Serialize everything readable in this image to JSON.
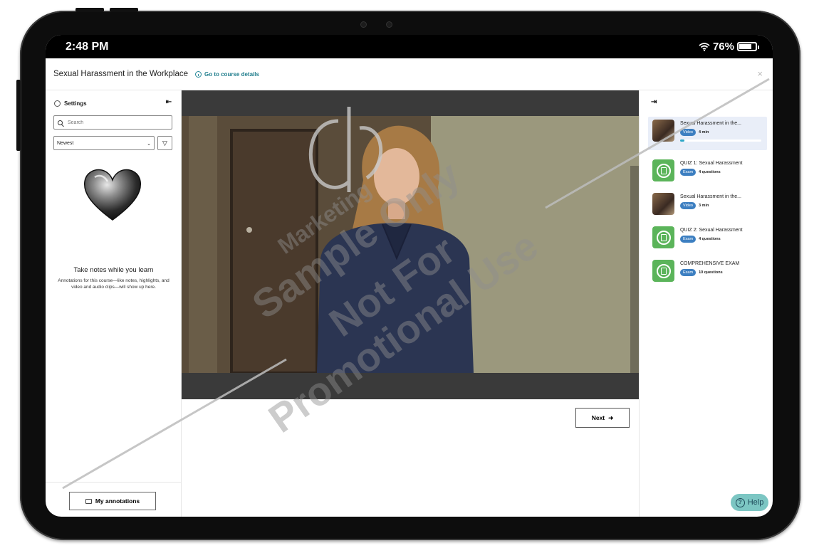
{
  "status": {
    "time": "2:48 PM",
    "battery": "76%",
    "battery_fraction": 0.76
  },
  "header": {
    "title": "Sexual Harassment in the Workplace",
    "details_link": "Go to course details",
    "close": "×"
  },
  "left": {
    "settings_label": "Settings",
    "collapse_icon": "⇤",
    "search_placeholder": "Search",
    "sort_value": "Newest",
    "sort_chevron": "⌄",
    "filter_icon": "▽",
    "notes_title": "Take notes while you learn",
    "notes_description": "Annotations for this course—like notes, highlights, and video and audio clips—will show up here.",
    "annotations_button": "My annotations"
  },
  "center": {
    "next_label": "Next",
    "next_arrow": "➜"
  },
  "right": {
    "expand_icon": "⇥",
    "items": [
      {
        "title": "Sexual Harassment in the...",
        "type": "Video",
        "meta": "4 min",
        "progress": 0.05
      },
      {
        "title": "QUIZ 1: Sexual Harassment",
        "type": "Exam",
        "meta": "4 questions"
      },
      {
        "title": "Sexual Harassment in the...",
        "type": "Video",
        "meta": "3 min"
      },
      {
        "title": "QUIZ 2: Sexual Harassment",
        "type": "Exam",
        "meta": "4 questions"
      },
      {
        "title": "COMPREHENSIVE EXAM",
        "type": "Exam",
        "meta": "10 questions"
      }
    ]
  },
  "help": {
    "label": "Help",
    "icon": "?"
  },
  "watermark": {
    "line1": "Marketing",
    "line2": "Sample Only",
    "line3": "Not For",
    "line4": "Promotional Use"
  },
  "colors": {
    "accent": "#1f7d8c",
    "badge": "#3d7fc1",
    "exam_green": "#5bb45a",
    "help_bg": "#7cc6c3"
  }
}
